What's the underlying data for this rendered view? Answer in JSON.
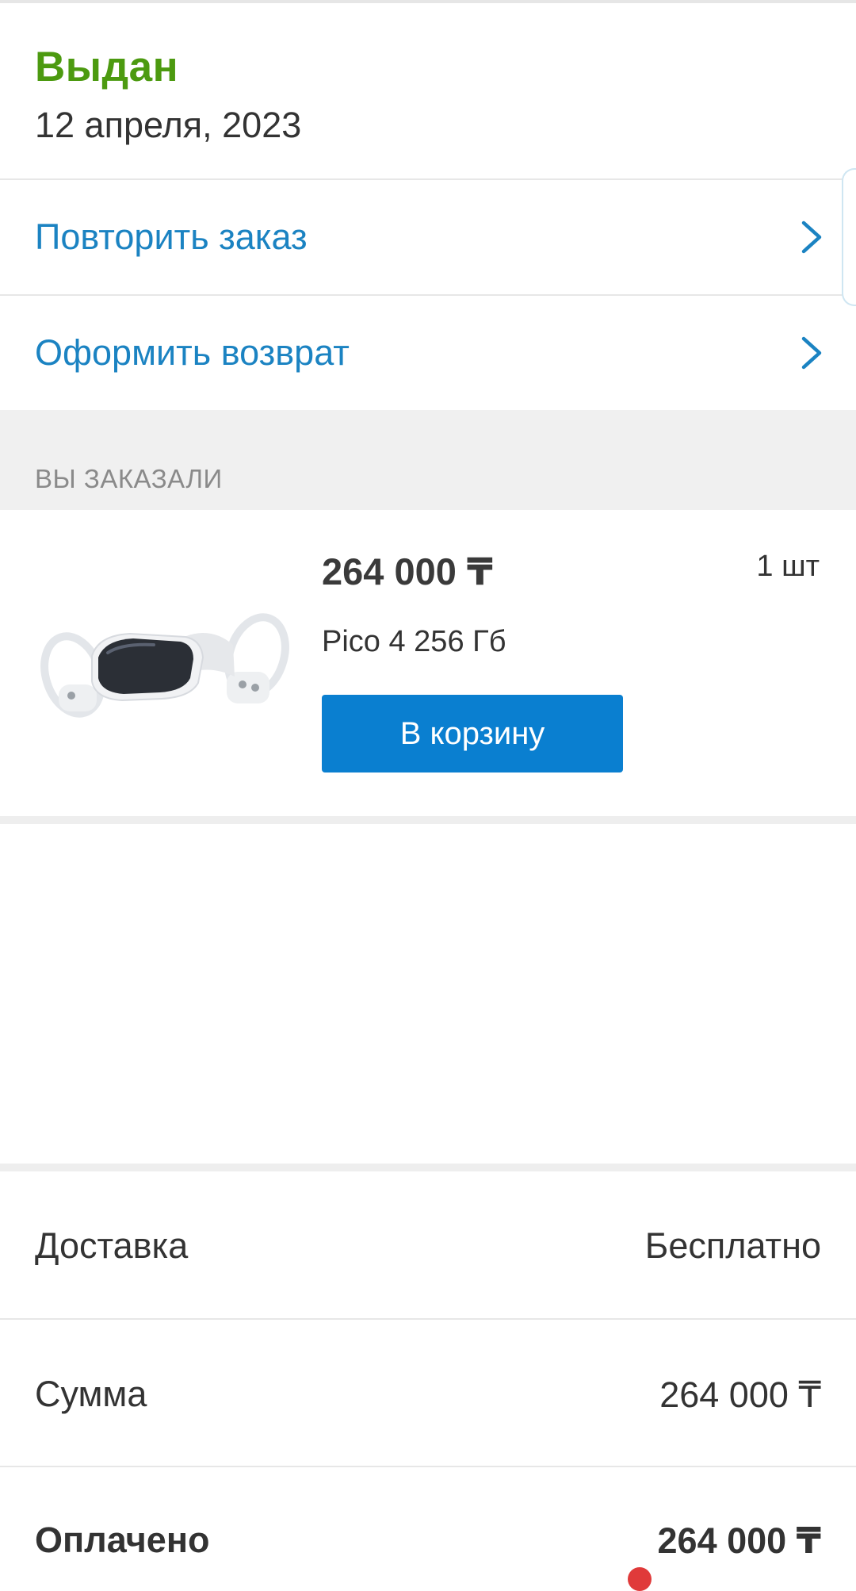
{
  "order": {
    "status": "Выдан",
    "status_color": "#4c9a10",
    "date": "12 апреля, 2023"
  },
  "actions": {
    "repeat_order": "Повторить заказ",
    "return_order": "Оформить возврат"
  },
  "icons": {
    "chevron": "chevron-right-icon",
    "product_image": "vr-headset-image"
  },
  "section": {
    "ordered_header": "ВЫ ЗАКАЗАЛИ"
  },
  "product": {
    "price": "264 000 ₸",
    "quantity": "1 шт",
    "name": "Pico 4 256 Гб",
    "cart_button": "В корзину"
  },
  "summary": {
    "delivery_label": "Доставка",
    "delivery_value": "Бесплатно",
    "sum_label": "Сумма",
    "sum_value": "264 000 ₸",
    "paid_label": "Оплачено",
    "paid_value": "264 000 ₸"
  },
  "colors": {
    "accent_link": "#1b83c2",
    "button": "#0a7fd0"
  }
}
